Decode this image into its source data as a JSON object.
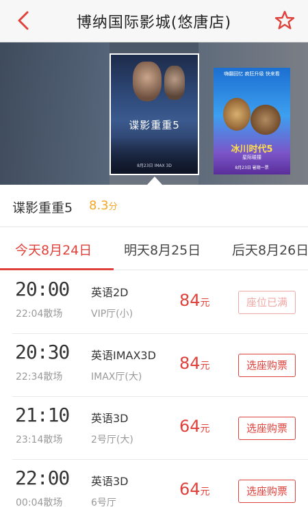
{
  "header": {
    "title": "博纳国际影城(悠唐店)",
    "accent_color": "#e0403a"
  },
  "posters": {
    "main": {
      "title": "谍影重重5",
      "date_line": "8月23日 IMAX 3D"
    },
    "side": {
      "header_line": "嗨翻回忆 疯狂升级 快来看",
      "title": "冰川时代5",
      "subtitle": "星际碰撞",
      "date_line": "8月23日 暑期一票"
    }
  },
  "movie": {
    "name": "谍影重重5",
    "score": "8.3",
    "score_unit": "分",
    "score_color": "#f5a623"
  },
  "tabs": [
    {
      "label": "今天8月24日",
      "active": true
    },
    {
      "label": "明天8月25日",
      "active": false
    },
    {
      "label": "后天8月26日",
      "active": false
    }
  ],
  "showtimes": [
    {
      "start": "20:00",
      "end": "22:04散场",
      "lang": "英语2D",
      "hall": "VIP厅(小)",
      "price": "84",
      "price_unit": "元",
      "button": "座位已满",
      "sold_out": true
    },
    {
      "start": "20:30",
      "end": "22:34散场",
      "lang": "英语IMAX3D",
      "hall": "IMAX厅(大)",
      "price": "84",
      "price_unit": "元",
      "button": "选座购票",
      "sold_out": false
    },
    {
      "start": "21:10",
      "end": "23:14散场",
      "lang": "英语3D",
      "hall": "2号厅(大)",
      "price": "64",
      "price_unit": "元",
      "button": "选座购票",
      "sold_out": false
    },
    {
      "start": "22:00",
      "end": "00:04散场",
      "lang": "英语3D",
      "hall": "6号厅",
      "price": "64",
      "price_unit": "元",
      "button": "选座购票",
      "sold_out": false
    }
  ],
  "icons": {
    "back": "chevron-left-icon",
    "favorite": "star-outline-icon"
  }
}
